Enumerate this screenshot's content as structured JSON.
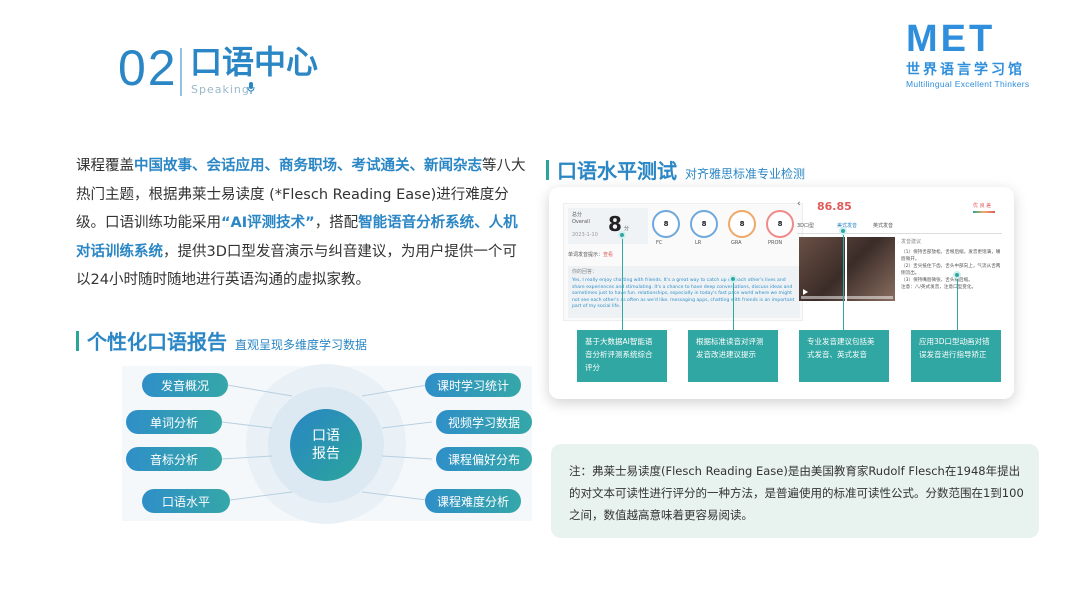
{
  "header": {
    "number": "02",
    "title": "口语中心",
    "subtitle": "Speaking"
  },
  "logo": {
    "brand": "MET",
    "cn": "世界语言学习馆",
    "en": "Multilingual  Excellent  Thinkers"
  },
  "intro": {
    "p1": "课程覆盖",
    "h1": "中国故事、会话应用、商务职场、考试通关、新闻杂志",
    "p2": "等八大热门主题，根据弗莱士易读度 (*Flesch Reading Ease)进行难度分级。口语训练功能采用",
    "h2": "“AI评测技术”",
    "p3": "，搭配",
    "h3": "智能语音分析系统、人机对话训练系统",
    "p4": "，提供3D口型发音演示与纠音建议，为用户提供一个可以24小时随时随地进行英语沟通的虚拟家教。"
  },
  "report": {
    "title": "个性化口语报告",
    "subtitle": "直观呈现多维度学习数据",
    "center_line1": "口语",
    "center_line2": "报告",
    "left_items": [
      "发音概况",
      "单词分析",
      "音标分析",
      "口语水平"
    ],
    "right_items": [
      "课时学习统计",
      "视频学习数据",
      "课程偏好分布",
      "课程难度分析"
    ]
  },
  "level_test": {
    "title": "口语水平测试",
    "subtitle": "对齐雅思标准专业检测",
    "screenshot": {
      "overall_label": "总分",
      "overall_sub": "Overall",
      "overall_score": "8",
      "overall_unit": "分",
      "date": "2023-1-10",
      "metrics": [
        {
          "score": "8",
          "name": "流利",
          "abbr": "FC"
        },
        {
          "score": "8",
          "name": "词汇",
          "abbr": "LR"
        },
        {
          "score": "8",
          "name": "语法",
          "abbr": "GRA"
        },
        {
          "score": "8",
          "name": "发音",
          "abbr": "PRON"
        }
      ],
      "question_label": "单词发音提示：",
      "question_value": "查看",
      "answer_label": "你的回答：",
      "answer_text": "Yes, I really enjoy chatting with friends. It's a great way to catch up on each other's lives and share experiences and stimulating. It's a chance to have deep conversations, discuss ideas and sometimes just to have fun. relationships, especially in today's fast pace world where we might not see each other's as often as we'd like. messaging apps, chatting with friends is an important part of my social life.",
      "right_score": "86.85",
      "right_tag": "优 良 差",
      "tab_3d": "3D口型",
      "tab_us": "美式发音",
      "tab_uk": "英式发音",
      "advice_title": "发音建议",
      "advice_lines": [
        "（1）保持舌部放松，舌根后缩，发音更饱满，嘴唇微开。",
        "（2）舌尖抵住下齿，舌头中部向上，气流从舌两侧流出。",
        "（3）保持嘴唇微张，舌头稍后缩。",
        "注意：八/英式发音，注意口型变化。"
      ]
    },
    "callouts": [
      "基于大数据AI智能语音分析评测系统综合评分",
      "根据标准读音对评测发音改进建议提示",
      "专业发音建议包括美式发音、英式发音",
      "应用3D口型动画对错误发音进行指导矫正"
    ]
  },
  "note": {
    "text": "注：弗莱士易读度(Flesch Reading Ease)是由美国教育家Rudolf Flesch在1948年提出的对文本可读性进行评分的一种方法，是普遍使用的标准可读性公式。分数范围在1到100之间，数值越高意味着更容易阅读。"
  },
  "colors": {
    "primary": "#2a86c4",
    "teal": "#31a7a3",
    "note_bg": "#e8f2ef"
  }
}
